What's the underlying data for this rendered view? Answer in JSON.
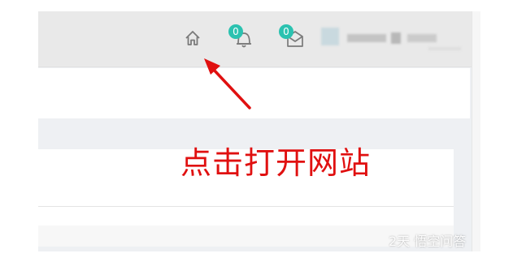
{
  "header": {
    "notifications": {
      "icon": "bell-icon",
      "count": "0"
    },
    "messages": {
      "icon": "mail-icon",
      "count": "0"
    },
    "home": {
      "icon": "home-icon"
    }
  },
  "annotation": {
    "text": "点击打开网站",
    "color": "#e01010"
  },
  "watermark": {
    "text": "2天 悟空问答"
  },
  "colors": {
    "badge": "#2bc2b0",
    "arrow": "#e01010",
    "topbar": "#e9e9e9"
  }
}
